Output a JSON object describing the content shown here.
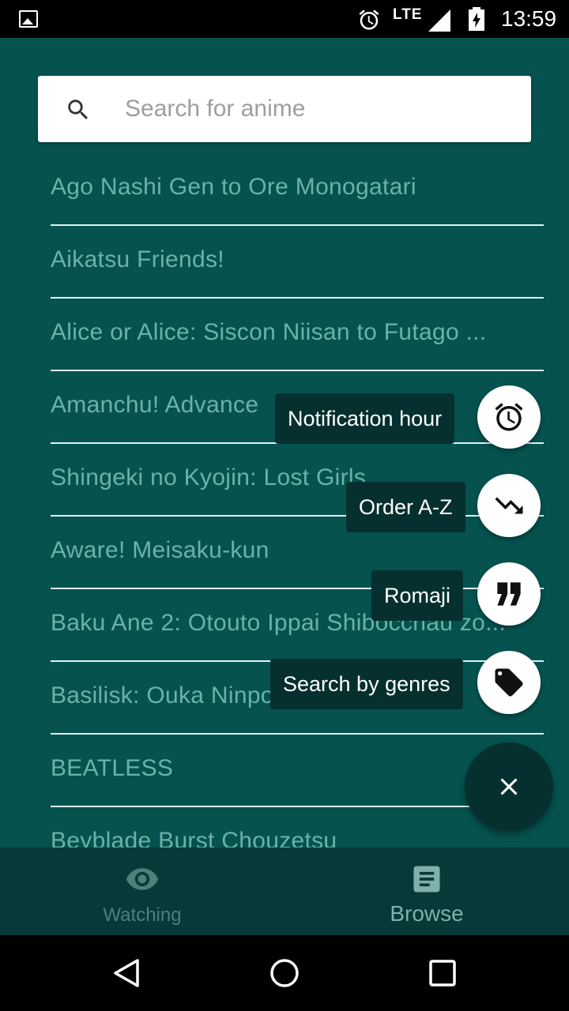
{
  "status_bar": {
    "network": "LTE",
    "time": "13:59",
    "icons": [
      "image-icon",
      "alarm-icon",
      "signal-icon",
      "battery-charging-icon"
    ]
  },
  "search": {
    "placeholder": "Search for anime",
    "value": ""
  },
  "anime_list": [
    "Ago Nashi Gen to Ore Monogatari",
    "Aikatsu Friends!",
    "Alice or Alice: Siscon Niisan to Futago ...",
    "Amanchu! Advance",
    "Shingeki no Kyojin: Lost Girls",
    "Aware! Meisaku-kun",
    "Baku Ane 2: Otouto Ippai Shibocchau zo...",
    "Basilisk: Ouka Ninpouchou",
    "BEATLESS",
    "Beyblade Burst Chouzetsu"
  ],
  "speed_dial": {
    "actions": [
      {
        "label": "Notification hour",
        "icon": "alarm-icon"
      },
      {
        "label": "Order A-Z",
        "icon": "trending-down-icon"
      },
      {
        "label": "Romaji",
        "icon": "quote-icon"
      },
      {
        "label": "Search by genres",
        "icon": "tag-icon"
      }
    ],
    "close_icon": "close-icon"
  },
  "bottom_nav": {
    "watching": {
      "label": "Watching",
      "icon": "eye-icon"
    },
    "browse": {
      "label": "Browse",
      "icon": "article-icon"
    }
  },
  "colors": {
    "app_background": "#05524f",
    "list_text": "#6bb2a7",
    "fab_dark": "#06302f",
    "bottom_nav": "#053a38"
  }
}
